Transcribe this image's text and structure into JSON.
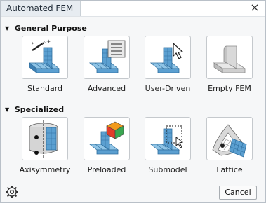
{
  "window": {
    "title": "Automated FEM",
    "close_glyph": "×"
  },
  "sections": [
    {
      "title": "General Purpose",
      "items": [
        {
          "label": "Standard",
          "icon": "standard-fem-icon"
        },
        {
          "label": "Advanced",
          "icon": "advanced-fem-icon"
        },
        {
          "label": "User-Driven",
          "icon": "user-driven-fem-icon"
        },
        {
          "label": "Empty FEM",
          "icon": "empty-fem-icon"
        }
      ]
    },
    {
      "title": "Specialized",
      "items": [
        {
          "label": "Axisymmetry",
          "icon": "axisymmetry-fem-icon"
        },
        {
          "label": "Preloaded",
          "icon": "preloaded-fem-icon"
        },
        {
          "label": "Submodel",
          "icon": "submodel-fem-icon"
        },
        {
          "label": "Lattice",
          "icon": "lattice-fem-icon"
        }
      ]
    }
  ],
  "footer": {
    "cancel_label": "Cancel",
    "settings_icon": "gear-icon"
  },
  "colors": {
    "mesh_blue": "#5b9fd0",
    "mesh_light": "#8fc4e6",
    "part_grey": "#d9d9d9",
    "accent_orange": "#f29b1d"
  }
}
